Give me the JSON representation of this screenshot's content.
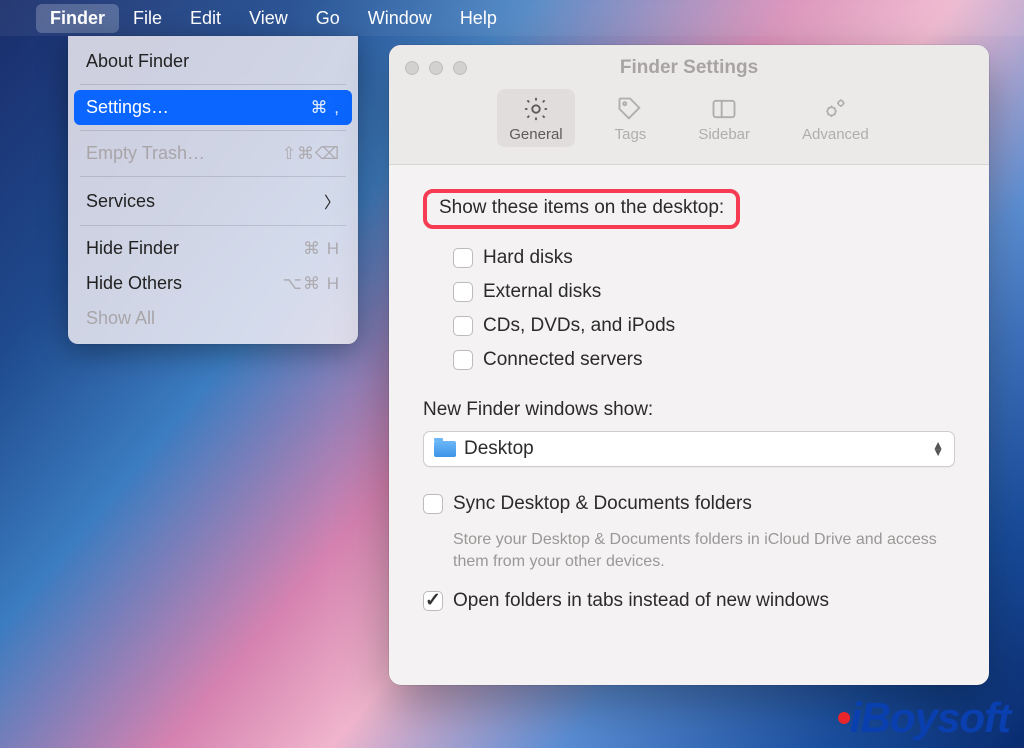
{
  "menubar": {
    "items": [
      "Finder",
      "File",
      "Edit",
      "View",
      "Go",
      "Window",
      "Help"
    ],
    "active_index": 0
  },
  "dropdown": {
    "about": "About Finder",
    "settings": "Settings…",
    "settings_shortcut": "⌘ ,",
    "empty_trash": "Empty Trash…",
    "empty_trash_shortcut": "⇧⌘⌫",
    "services": "Services",
    "hide_finder": "Hide Finder",
    "hide_finder_shortcut": "⌘ H",
    "hide_others": "Hide Others",
    "hide_others_shortcut": "⌥⌘ H",
    "show_all": "Show All"
  },
  "window": {
    "title": "Finder Settings",
    "tabs": {
      "general": "General",
      "tags": "Tags",
      "sidebar": "Sidebar",
      "advanced": "Advanced"
    },
    "section_desktop": "Show these items on the desktop:",
    "checks": {
      "hard_disks": "Hard disks",
      "external_disks": "External disks",
      "cds": "CDs, DVDs, and iPods",
      "servers": "Connected servers"
    },
    "new_windows_label": "New Finder windows show:",
    "select_value": "Desktop",
    "sync_label": "Sync Desktop & Documents folders",
    "sync_helper": "Store your Desktop & Documents folders in iCloud Drive and access them from your other devices.",
    "open_tabs_label": "Open folders in tabs instead of new windows"
  },
  "watermark": {
    "prefix": "iBoy",
    "suffix": "soft"
  }
}
